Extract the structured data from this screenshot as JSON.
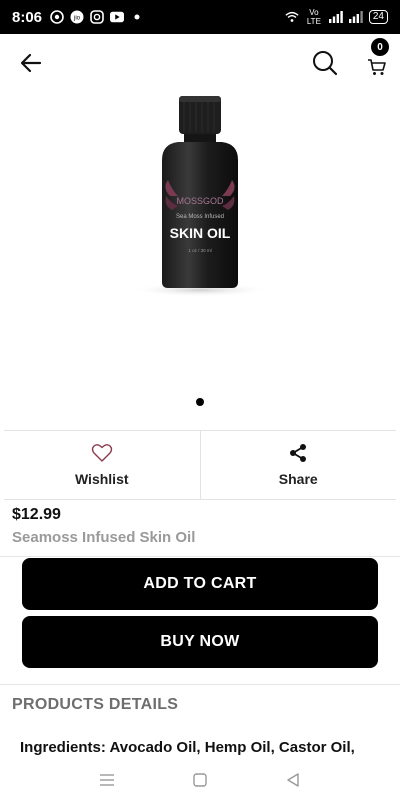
{
  "status_bar": {
    "time": "8:06",
    "battery": "24",
    "network": "Vo LTE"
  },
  "app_bar": {
    "cart_count": "0"
  },
  "carousel": {
    "dots": 1
  },
  "product_image": {
    "brand_text": "MOSSGOD",
    "sub_text": "Sea Moss Infused",
    "title_text": "SKIN OIL",
    "volume_text": "1 oz / 30 ml"
  },
  "actions": {
    "wishlist_label": "Wishlist",
    "share_label": "Share"
  },
  "product": {
    "price": "$12.99",
    "name": "Seamoss Infused Skin Oil"
  },
  "buttons": {
    "add_to_cart": "ADD TO CART",
    "buy_now": "BUY NOW"
  },
  "details": {
    "title": "PRODUCTS DETAILS",
    "ingredients": "Ingredients: Avocado Oil, Hemp Oil, Castor Oil,"
  },
  "colors": {
    "primary": "#000000",
    "muted_text": "#9a9a9a",
    "wishlist_heart": "#8a3a4a"
  }
}
